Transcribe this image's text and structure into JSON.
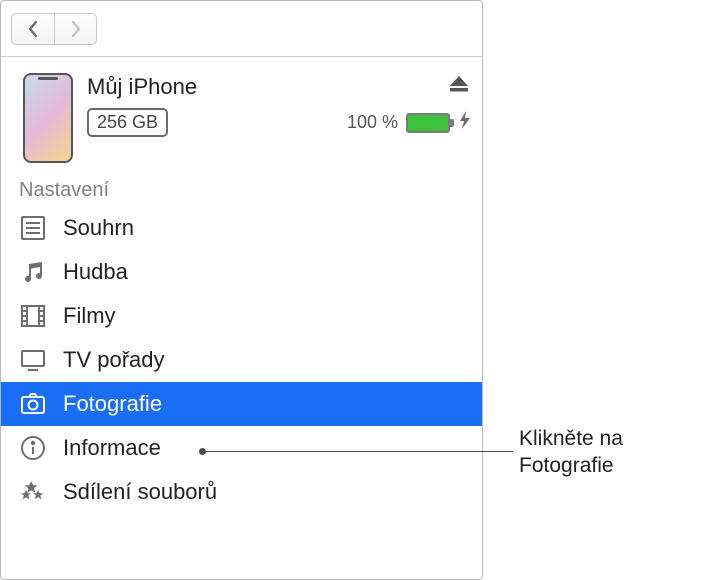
{
  "device": {
    "name": "Můj iPhone",
    "capacity": "256 GB",
    "battery_percent": "100 %"
  },
  "sidebar": {
    "section_label": "Nastavení",
    "items": [
      {
        "label": "Souhrn",
        "icon": "summary-icon"
      },
      {
        "label": "Hudba",
        "icon": "music-icon"
      },
      {
        "label": "Filmy",
        "icon": "movies-icon"
      },
      {
        "label": "TV pořady",
        "icon": "tv-icon"
      },
      {
        "label": "Fotografie",
        "icon": "photos-icon",
        "selected": true
      },
      {
        "label": "Informace",
        "icon": "info-icon"
      },
      {
        "label": "Sdílení souborů",
        "icon": "file-sharing-icon"
      }
    ]
  },
  "callout": {
    "line1": "Klikněte na",
    "line2": "Fotografie"
  }
}
